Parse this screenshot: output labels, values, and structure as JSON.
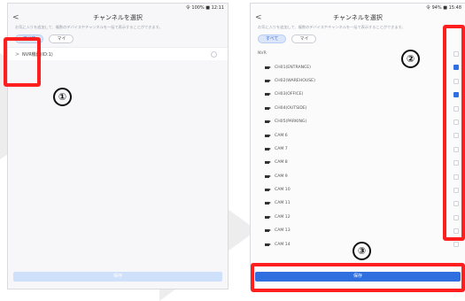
{
  "left": {
    "status_text": "令 100% ■ 12:11",
    "back_glyph": "<",
    "title": "チャンネルを選択",
    "note": "お気に入りを追加して、複数のデバイスやチャンネルを一括で表示することができます。",
    "tabs": [
      "すべて",
      "マイ"
    ],
    "device_label": "NVR機器(ID:1)",
    "device_chevron": ">",
    "confirm_label": "保存"
  },
  "right": {
    "status_text": "令 94% ■ 15:48",
    "back_glyph": "<",
    "title": "チャンネルを選択",
    "note": "お気に入りを追加して、複数のデバイスやチャンネルを一括で表示することができます。",
    "tabs": [
      "すべて",
      "マイ"
    ],
    "group_label": "NVR",
    "channels": [
      {
        "label": "CH01(ENTRANCE)",
        "checked": true
      },
      {
        "label": "CH02(WAREHOUSE)",
        "checked": false
      },
      {
        "label": "CH03(OFFICE)",
        "checked": true
      },
      {
        "label": "CH04(OUTSIDE)",
        "checked": false
      },
      {
        "label": "CH05(PARKING)",
        "checked": false
      },
      {
        "label": "CAM 6",
        "checked": false
      },
      {
        "label": "CAM 7",
        "checked": false
      },
      {
        "label": "CAM 8",
        "checked": false
      },
      {
        "label": "CAM 9",
        "checked": false
      },
      {
        "label": "CAM 10",
        "checked": false
      },
      {
        "label": "CAM 11",
        "checked": false
      },
      {
        "label": "CAM 12",
        "checked": false
      },
      {
        "label": "CAM 13",
        "checked": false
      },
      {
        "label": "CAM 14",
        "checked": false
      }
    ],
    "confirm_label": "保存"
  },
  "markers": [
    "①",
    "②",
    "③"
  ],
  "colors": {
    "highlight": "#ff1f1f",
    "primary": "#2f6fe0",
    "tab_active": "#dbe6fb"
  }
}
